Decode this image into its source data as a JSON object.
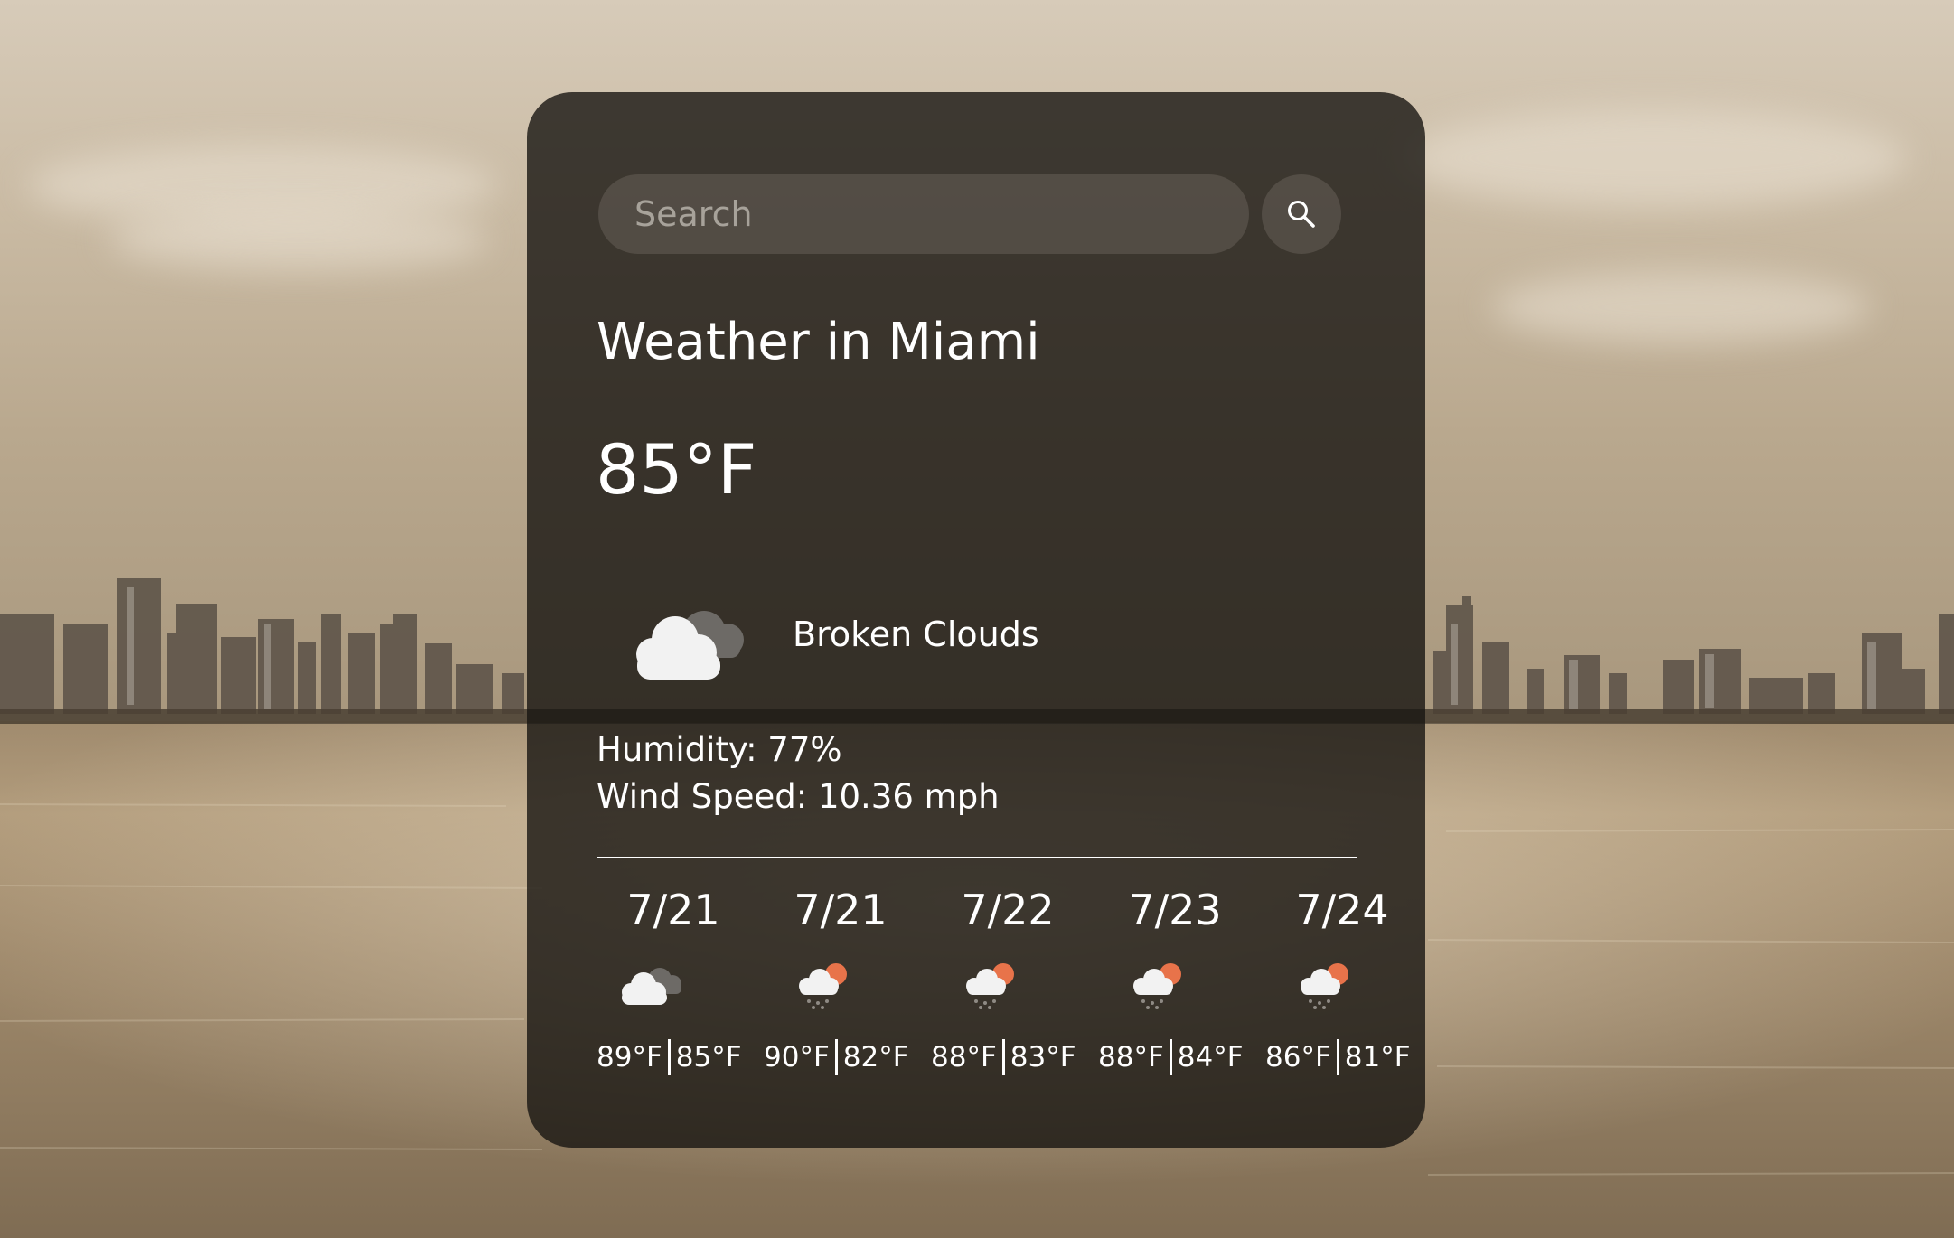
{
  "search": {
    "placeholder": "Search",
    "value": ""
  },
  "weather": {
    "title": "Weather in Miami",
    "temperature": "85°F",
    "condition": "Broken Clouds",
    "condition_icon": "broken-clouds-icon",
    "humidity": "Humidity: 77%",
    "wind": "Wind Speed: 10.36 mph"
  },
  "forecast": [
    {
      "date": "7/21",
      "icon": "broken-clouds-icon",
      "high": "89°F",
      "low": "85°F"
    },
    {
      "date": "7/21",
      "icon": "sun-rain-icon",
      "high": "90°F",
      "low": "82°F"
    },
    {
      "date": "7/22",
      "icon": "sun-rain-icon",
      "high": "88°F",
      "low": "83°F"
    },
    {
      "date": "7/23",
      "icon": "sun-rain-icon",
      "high": "88°F",
      "low": "84°F"
    },
    {
      "date": "7/24",
      "icon": "sun-rain-icon",
      "high": "86°F",
      "low": "81°F"
    }
  ],
  "colors": {
    "card": "#181512",
    "sun": "#e8734a",
    "cloud": "#f2f2f2",
    "dark_cloud": "#6d6a66"
  }
}
